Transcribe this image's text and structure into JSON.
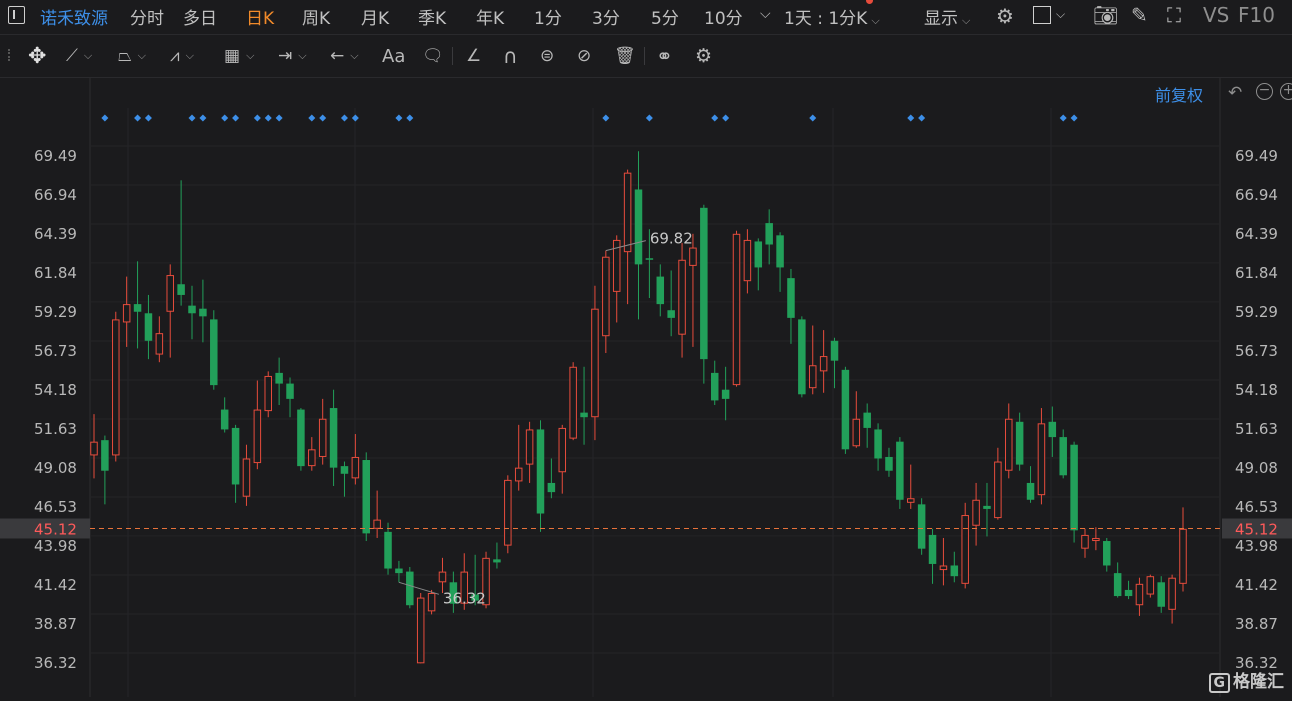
{
  "header": {
    "stock_name": "诺禾致源",
    "tabs": [
      {
        "label": "分时",
        "active": false
      },
      {
        "label": "多日",
        "active": false
      },
      {
        "label": "日K",
        "active": true
      },
      {
        "label": "周K",
        "active": false
      },
      {
        "label": "月K",
        "active": false
      },
      {
        "label": "季K",
        "active": false
      },
      {
        "label": "年K",
        "active": false
      },
      {
        "label": "1分",
        "active": false
      },
      {
        "label": "3分",
        "active": false
      },
      {
        "label": "5分",
        "active": false
      },
      {
        "label": "10分",
        "active": false
      }
    ],
    "period_select": "1天 : 1分K",
    "display_label": "显示",
    "vs_label": "VS",
    "f10_label": "F10"
  },
  "toolbar": {
    "font_label": "Aa"
  },
  "chart_controls": {
    "adjust_label": "前复权"
  },
  "watermark": "格隆汇",
  "colors": {
    "up": "#e74c3c",
    "down": "#22a05a",
    "accent": "#f08a2a",
    "link": "#3d8fe8",
    "marker": "#3d8fe8",
    "current_price_line": "#e8723a"
  },
  "chart_data": {
    "type": "candlestick",
    "y_ticks": [
      69.49,
      66.94,
      64.39,
      61.84,
      59.29,
      56.73,
      54.18,
      51.63,
      49.08,
      46.53,
      43.98,
      41.42,
      38.87,
      36.32
    ],
    "y_tick_labels": [
      "69.49",
      "66.94",
      "64.39",
      "61.84",
      "59.29",
      "56.73",
      "54.18",
      "51.63",
      "49.08",
      "46.53",
      "43.98",
      "41.42",
      "38.87",
      "36.32"
    ],
    "ylim": [
      35.8,
      70.9
    ],
    "current_price": 45.12,
    "current_price_label": "45.12",
    "max_label": "69.82",
    "min_label": "36.32",
    "max_index": 47,
    "min_index": 28,
    "marker_indices": [
      1,
      4,
      5,
      9,
      10,
      12,
      13,
      15,
      16,
      17,
      20,
      21,
      23,
      24,
      28,
      29,
      47,
      51,
      57,
      58,
      66,
      75,
      76,
      89,
      90
    ],
    "candles": [
      {
        "o": 49.9,
        "c": 50.8,
        "h": 52.6,
        "l": 48.4
      },
      {
        "o": 50.9,
        "c": 48.9,
        "h": 51.2,
        "l": 46.7
      },
      {
        "o": 49.9,
        "c": 58.8,
        "h": 59.3,
        "l": 49.5
      },
      {
        "o": 58.6,
        "c": 59.8,
        "h": 61.6,
        "l": 57.0
      },
      {
        "o": 59.8,
        "c": 59.3,
        "h": 62.6,
        "l": 56.9
      },
      {
        "o": 59.2,
        "c": 57.4,
        "h": 60.4,
        "l": 56.2
      },
      {
        "o": 56.5,
        "c": 57.9,
        "h": 59.0,
        "l": 56.0
      },
      {
        "o": 59.3,
        "c": 61.7,
        "h": 62.4,
        "l": 56.3
      },
      {
        "o": 61.1,
        "c": 60.4,
        "h": 67.9,
        "l": 59.7
      },
      {
        "o": 59.7,
        "c": 59.2,
        "h": 61.0,
        "l": 57.5
      },
      {
        "o": 59.5,
        "c": 59.0,
        "h": 61.4,
        "l": 57.3
      },
      {
        "o": 58.8,
        "c": 54.5,
        "h": 59.4,
        "l": 54.2
      },
      {
        "o": 52.9,
        "c": 51.6,
        "h": 53.7,
        "l": 51.4
      },
      {
        "o": 51.7,
        "c": 48.0,
        "h": 51.9,
        "l": 46.8
      },
      {
        "o": 47.2,
        "c": 49.7,
        "h": 50.6,
        "l": 46.6
      },
      {
        "o": 49.4,
        "c": 52.9,
        "h": 54.8,
        "l": 49.0
      },
      {
        "o": 52.8,
        "c": 55.1,
        "h": 55.4,
        "l": 52.4
      },
      {
        "o": 55.3,
        "c": 54.6,
        "h": 56.3,
        "l": 53.2
      },
      {
        "o": 54.6,
        "c": 53.6,
        "h": 55.0,
        "l": 52.4
      },
      {
        "o": 52.9,
        "c": 49.2,
        "h": 53.0,
        "l": 48.9
      },
      {
        "o": 49.2,
        "c": 50.3,
        "h": 51.1,
        "l": 48.9
      },
      {
        "o": 49.8,
        "c": 52.3,
        "h": 53.6,
        "l": 49.3
      },
      {
        "o": 53.0,
        "c": 49.1,
        "h": 54.2,
        "l": 47.9
      },
      {
        "o": 49.2,
        "c": 48.7,
        "h": 49.5,
        "l": 47.2
      },
      {
        "o": 48.4,
        "c": 49.8,
        "h": 51.3,
        "l": 48.0
      },
      {
        "o": 49.6,
        "c": 44.8,
        "h": 50.1,
        "l": 44.3
      },
      {
        "o": 45.1,
        "c": 45.7,
        "h": 47.6,
        "l": 44.5
      },
      {
        "o": 44.9,
        "c": 42.5,
        "h": 45.5,
        "l": 42.1
      },
      {
        "o": 42.5,
        "c": 42.2,
        "h": 43.0,
        "l": 41.6
      },
      {
        "o": 42.3,
        "c": 40.1,
        "h": 42.6,
        "l": 39.9
      },
      {
        "o": 36.3,
        "c": 40.6,
        "h": 40.9,
        "l": 36.3
      },
      {
        "o": 39.7,
        "c": 40.9,
        "h": 41.1,
        "l": 39.5
      },
      {
        "o": 41.6,
        "c": 42.3,
        "h": 43.2,
        "l": 40.9
      },
      {
        "o": 41.6,
        "c": 40.2,
        "h": 42.3,
        "l": 39.6
      },
      {
        "o": 40.2,
        "c": 42.3,
        "h": 43.5,
        "l": 39.8
      },
      {
        "o": 40.8,
        "c": 40.4,
        "h": 43.4,
        "l": 40.1
      },
      {
        "o": 40.1,
        "c": 43.2,
        "h": 43.6,
        "l": 39.9
      },
      {
        "o": 43.1,
        "c": 42.9,
        "h": 44.2,
        "l": 42.5
      },
      {
        "o": 44.0,
        "c": 48.3,
        "h": 48.6,
        "l": 43.5
      },
      {
        "o": 48.2,
        "c": 49.1,
        "h": 51.9,
        "l": 47.6
      },
      {
        "o": 49.3,
        "c": 51.6,
        "h": 52.1,
        "l": 48.1
      },
      {
        "o": 51.6,
        "c": 46.1,
        "h": 52.2,
        "l": 44.9
      },
      {
        "o": 48.1,
        "c": 47.5,
        "h": 49.7,
        "l": 47.1
      },
      {
        "o": 48.8,
        "c": 51.7,
        "h": 51.9,
        "l": 47.4
      },
      {
        "o": 51.0,
        "c": 55.7,
        "h": 56.0,
        "l": 50.9
      },
      {
        "o": 52.7,
        "c": 52.4,
        "h": 55.7,
        "l": 50.6
      },
      {
        "o": 52.4,
        "c": 59.5,
        "h": 61.0,
        "l": 50.9
      },
      {
        "o": 57.7,
        "c": 62.9,
        "h": 63.3,
        "l": 56.6
      },
      {
        "o": 60.6,
        "c": 64.0,
        "h": 64.3,
        "l": 58.6
      },
      {
        "o": 63.2,
        "c": 68.4,
        "h": 68.6,
        "l": 59.8
      },
      {
        "o": 67.3,
        "c": 62.4,
        "h": 69.8,
        "l": 58.8
      },
      {
        "o": 62.8,
        "c": 62.7,
        "h": 64.7,
        "l": 60.2
      },
      {
        "o": 61.6,
        "c": 59.8,
        "h": 62.4,
        "l": 59.0
      },
      {
        "o": 59.4,
        "c": 58.9,
        "h": 62.0,
        "l": 57.7
      },
      {
        "o": 57.8,
        "c": 62.7,
        "h": 63.8,
        "l": 56.3
      },
      {
        "o": 62.3,
        "c": 63.5,
        "h": 64.4,
        "l": 57.0
      },
      {
        "o": 66.1,
        "c": 56.2,
        "h": 66.3,
        "l": 54.6
      },
      {
        "o": 55.3,
        "c": 53.5,
        "h": 56.1,
        "l": 53.2
      },
      {
        "o": 54.2,
        "c": 53.6,
        "h": 55.7,
        "l": 52.2
      },
      {
        "o": 54.5,
        "c": 64.4,
        "h": 64.6,
        "l": 54.4
      },
      {
        "o": 61.3,
        "c": 64.0,
        "h": 64.7,
        "l": 60.5
      },
      {
        "o": 63.9,
        "c": 62.2,
        "h": 64.1,
        "l": 60.7
      },
      {
        "o": 65.1,
        "c": 63.7,
        "h": 66.0,
        "l": 62.4
      },
      {
        "o": 64.3,
        "c": 62.2,
        "h": 64.5,
        "l": 60.6
      },
      {
        "o": 61.5,
        "c": 58.9,
        "h": 62.1,
        "l": 57.2
      },
      {
        "o": 58.8,
        "c": 53.9,
        "h": 59.0,
        "l": 53.7
      },
      {
        "o": 54.3,
        "c": 55.8,
        "h": 58.4,
        "l": 53.9
      },
      {
        "o": 55.4,
        "c": 56.4,
        "h": 58.1,
        "l": 54.0
      },
      {
        "o": 57.4,
        "c": 56.1,
        "h": 57.6,
        "l": 54.3
      },
      {
        "o": 55.5,
        "c": 50.3,
        "h": 55.7,
        "l": 50.0
      },
      {
        "o": 50.5,
        "c": 52.3,
        "h": 54.1,
        "l": 50.4
      },
      {
        "o": 52.7,
        "c": 51.7,
        "h": 53.3,
        "l": 50.4
      },
      {
        "o": 51.6,
        "c": 49.7,
        "h": 52.0,
        "l": 48.9
      },
      {
        "o": 49.8,
        "c": 48.9,
        "h": 50.4,
        "l": 48.5
      },
      {
        "o": 50.8,
        "c": 47.0,
        "h": 51.1,
        "l": 46.4
      },
      {
        "o": 46.8,
        "c": 47.1,
        "h": 49.3,
        "l": 46.4
      },
      {
        "o": 46.7,
        "c": 43.8,
        "h": 47.1,
        "l": 43.4
      },
      {
        "o": 44.7,
        "c": 42.8,
        "h": 45.1,
        "l": 41.5
      },
      {
        "o": 42.4,
        "c": 42.7,
        "h": 44.5,
        "l": 41.4
      },
      {
        "o": 42.7,
        "c": 42.0,
        "h": 43.6,
        "l": 41.6
      },
      {
        "o": 41.5,
        "c": 46.0,
        "h": 46.8,
        "l": 41.2
      },
      {
        "o": 45.3,
        "c": 47.0,
        "h": 48.1,
        "l": 44.0
      },
      {
        "o": 46.6,
        "c": 46.4,
        "h": 48.1,
        "l": 44.6
      },
      {
        "o": 45.8,
        "c": 49.5,
        "h": 50.4,
        "l": 45.7
      },
      {
        "o": 48.9,
        "c": 52.3,
        "h": 53.3,
        "l": 48.4
      },
      {
        "o": 52.1,
        "c": 49.3,
        "h": 52.7,
        "l": 48.9
      },
      {
        "o": 48.1,
        "c": 47.0,
        "h": 49.2,
        "l": 46.8
      },
      {
        "o": 47.3,
        "c": 52.0,
        "h": 53.0,
        "l": 46.7
      },
      {
        "o": 52.1,
        "c": 51.1,
        "h": 53.1,
        "l": 49.8
      },
      {
        "o": 51.1,
        "c": 48.6,
        "h": 51.6,
        "l": 48.4
      },
      {
        "o": 50.6,
        "c": 45.0,
        "h": 50.8,
        "l": 44.2
      },
      {
        "o": 43.8,
        "c": 44.7,
        "h": 45.1,
        "l": 43.2
      },
      {
        "o": 44.3,
        "c": 44.5,
        "h": 45.2,
        "l": 43.7
      },
      {
        "o": 44.3,
        "c": 42.7,
        "h": 44.5,
        "l": 42.3
      },
      {
        "o": 42.2,
        "c": 40.7,
        "h": 42.9,
        "l": 40.6
      },
      {
        "o": 41.1,
        "c": 40.7,
        "h": 41.7,
        "l": 40.5
      },
      {
        "o": 40.1,
        "c": 41.5,
        "h": 41.9,
        "l": 39.4
      },
      {
        "o": 40.8,
        "c": 42.0,
        "h": 42.1,
        "l": 40.6
      },
      {
        "o": 41.6,
        "c": 40.0,
        "h": 42.0,
        "l": 39.6
      },
      {
        "o": 39.8,
        "c": 41.9,
        "h": 42.1,
        "l": 38.9
      },
      {
        "o": 41.5,
        "c": 45.1,
        "h": 46.5,
        "l": 41.0
      }
    ]
  }
}
